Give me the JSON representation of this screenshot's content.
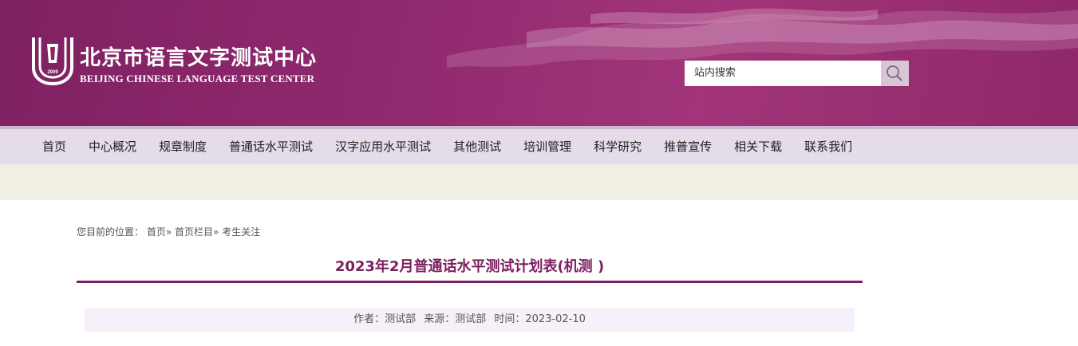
{
  "header": {
    "logo_cn": "北京市语言文字测试中心",
    "logo_en": "BEIJING CHINESE LANGUAGE TEST CENTER",
    "logo_emblem_text": "2009",
    "search": {
      "value": "站内搜索"
    }
  },
  "nav": {
    "items": [
      "首页",
      "中心概况",
      "规章制度",
      "普通话水平测试",
      "汉字应用水平测试",
      "其他测试",
      "培训管理",
      "科学研究",
      "推普宣传",
      "相关下载",
      "联系我们"
    ]
  },
  "breadcrumb": {
    "prefix": "您目前的位置：",
    "items": [
      "首页",
      "首页栏目",
      "考生关注"
    ],
    "separator": "»"
  },
  "article": {
    "title": "2023年2月普通话水平测试计划表(机测 )",
    "author": "作者：测试部",
    "source": "来源：测试部",
    "time": "时间：2023-02-10"
  },
  "colors": {
    "header_purple": "#922a70",
    "title_color": "#7c1f5e",
    "nav_bg": "#e5dcea",
    "band_bg": "#f1eee4"
  },
  "icons": {
    "search": "magnifier-icon",
    "logo": "emblem-icon"
  }
}
